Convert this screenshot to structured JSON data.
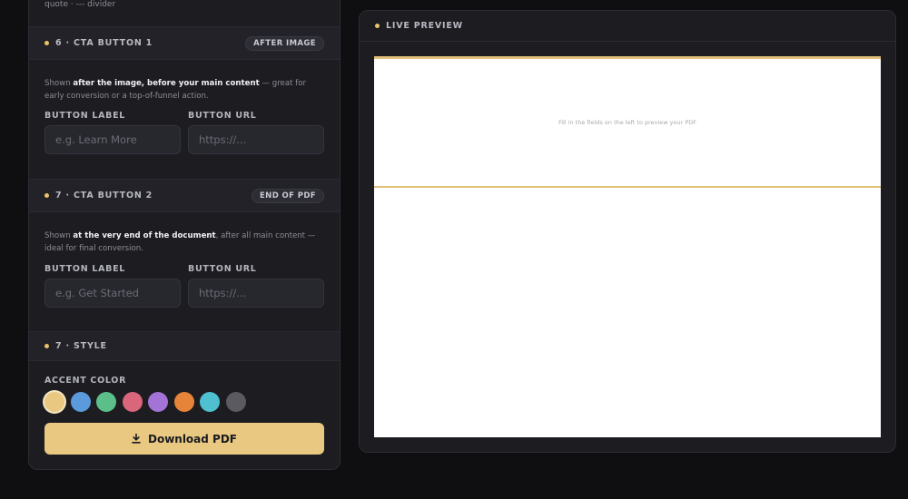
{
  "top_hint": "quote · --- divider",
  "sections": {
    "cta1": {
      "title": "6 · CTA BUTTON 1",
      "badge": "AFTER IMAGE",
      "desc_prefix": "Shown ",
      "desc_bold": "after the image, before your main content",
      "desc_suffix": " — great for early conversion or a top-of-funnel action.",
      "label_field_label": "BUTTON LABEL",
      "label_placeholder": "e.g. Learn More",
      "url_field_label": "BUTTON URL",
      "url_placeholder": "https://..."
    },
    "cta2": {
      "title": "7 · CTA BUTTON 2",
      "badge": "END OF PDF",
      "desc_prefix": "Shown ",
      "desc_bold": "at the very end of the document",
      "desc_suffix": ", after all main content — ideal for final conversion.",
      "label_field_label": "BUTTON LABEL",
      "label_placeholder": "e.g. Get Started",
      "url_field_label": "BUTTON URL",
      "url_placeholder": "https://..."
    },
    "style": {
      "title": "7 · STYLE",
      "accent_label": "ACCENT COLOR",
      "selected_color": "#e9c981",
      "colors": [
        "#e9c981",
        "#5b9bdc",
        "#5cbf8a",
        "#d9667b",
        "#a373d6",
        "#e6843a",
        "#4ec0d0",
        "#5a5a60"
      ]
    }
  },
  "download_button": {
    "label": "Download PDF",
    "icon": "download-icon"
  },
  "preview": {
    "title": "LIVE PREVIEW",
    "hint": "Fill in the fields on the left to preview your PDF",
    "accent": "#e2c27a"
  }
}
